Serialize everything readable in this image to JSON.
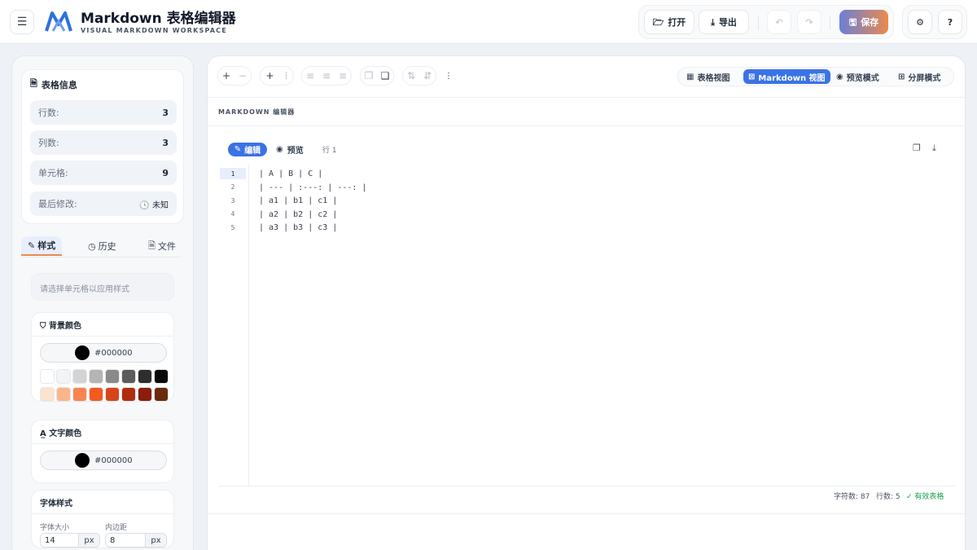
{
  "header": {
    "title": "Markdown 表格编辑器",
    "subtitle": "VISUAL MARKDOWN WORKSPACE",
    "open_label": "打开",
    "export_label": "导出",
    "save_label": "保存"
  },
  "info_card": {
    "title": "表格信息",
    "rows": [
      {
        "label": "行数:",
        "value": "3"
      },
      {
        "label": "列数:",
        "value": "3"
      },
      {
        "label": "单元格:",
        "value": "9"
      },
      {
        "label": "最后修改:",
        "value": "未知"
      }
    ]
  },
  "left_tabs": [
    "样式",
    "历史",
    "文件"
  ],
  "style_panel": {
    "hint": "请选择单元格以应用样式",
    "bg_title": "背景颜色",
    "bg_value": "#000000",
    "text_title": "文字颜色",
    "text_value": "#000000",
    "font_title": "字体样式",
    "font_size_label": "字体大小",
    "font_size_value": "14",
    "padding_label": "内边距",
    "padding_value": "8",
    "unit": "px",
    "swatches_row1": [
      "#ffffff",
      "#f3f4f6",
      "#d4d4d4",
      "#b5b5b5",
      "#8a8a8a",
      "#5c5c5c",
      "#2e2e2e",
      "#0a0a0a"
    ],
    "swatches_row2": [
      "#fde2cf",
      "#fbb58c",
      "#f8854f",
      "#f4591f",
      "#d8441a",
      "#b02e10",
      "#8b1d0a",
      "#6b2a0a"
    ]
  },
  "toolbar": {
    "view_buttons": [
      "表格视图",
      "Markdown 视图",
      "预览模式",
      "分屏模式"
    ]
  },
  "editor": {
    "section_label": "MARKDOWN 编辑器",
    "edit_label": "编辑",
    "preview_label": "预览",
    "line_indicator": "行 1",
    "line_numbers": [
      "1",
      "2",
      "3",
      "4",
      "5"
    ],
    "lines": [
      "| A | B | C |",
      "| --- | :---: | ---: |",
      "| a1 | b1 | c1 |",
      "| a2 | b2 | c2 |",
      "| a3 | b3 | c3 |"
    ]
  },
  "status": {
    "chars": "字符数: 87",
    "lines": "行数: 5",
    "valid": "✓ 有效表格"
  },
  "colors": {
    "accent": "#3b73e6",
    "save_gradient_start": "#6b7fd7",
    "save_gradient_end": "#e98a4f",
    "valid": "#16a34a"
  }
}
